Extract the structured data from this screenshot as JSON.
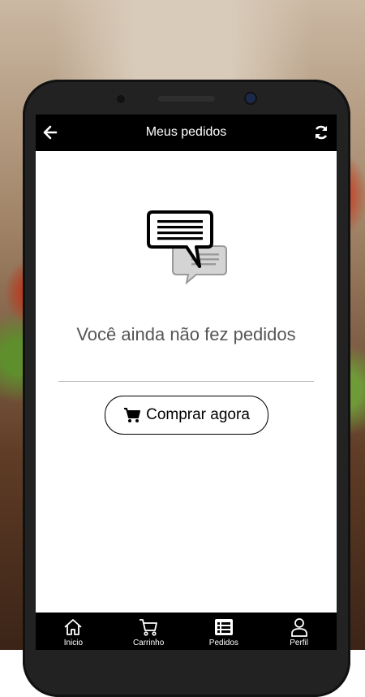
{
  "header": {
    "title": "Meus pedidos"
  },
  "empty_state": {
    "message": "Você ainda não fez pedidos"
  },
  "buy_button": {
    "label": "Comprar agora"
  },
  "nav": [
    {
      "label": "Inicio",
      "icon": "home-icon"
    },
    {
      "label": "Carrinho",
      "icon": "cart-icon"
    },
    {
      "label": "Pedidos",
      "icon": "list-icon"
    },
    {
      "label": "Perfil",
      "icon": "user-icon"
    }
  ]
}
